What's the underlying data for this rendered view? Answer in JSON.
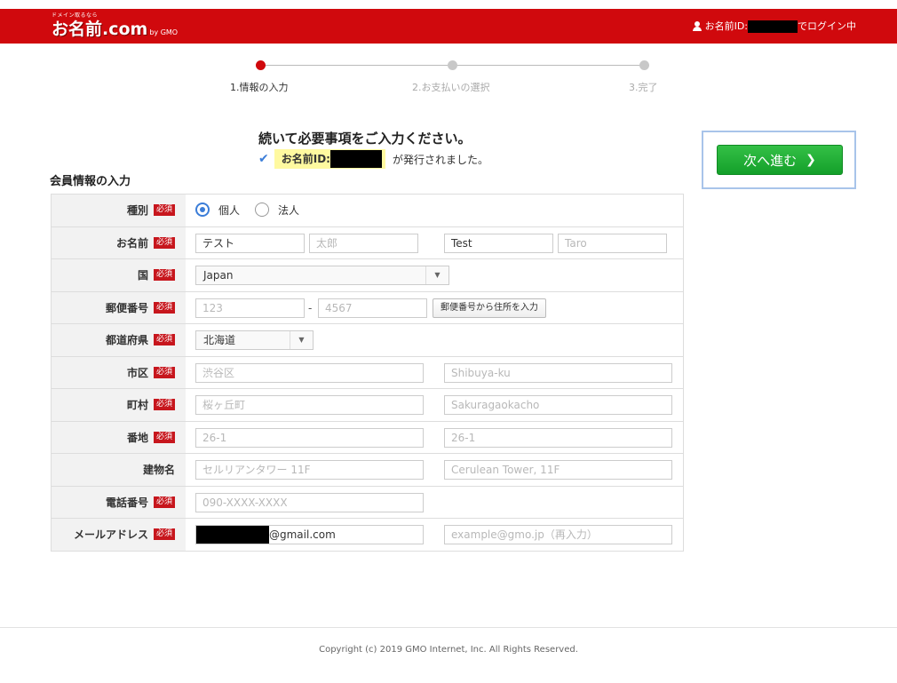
{
  "header": {
    "logo_tag": "ドメイン取るなら",
    "logo_main": "お名前.com",
    "logo_sub": "by GMO",
    "login_prefix": "お名前ID:",
    "login_suffix": "でログイン中"
  },
  "stepper": {
    "steps": [
      {
        "label": "1.情報の入力",
        "active": true
      },
      {
        "label": "2.お支払いの選択",
        "active": false
      },
      {
        "label": "3.完了",
        "active": false
      }
    ]
  },
  "lead": "続いて必要事項をご入力ください。",
  "notice": {
    "highlight_prefix": "お名前ID:",
    "rest": "が発行されました。"
  },
  "next_button": {
    "label": "次へ進む"
  },
  "section_title": "会員情報の入力",
  "required_badge": "必須",
  "form": {
    "type": {
      "label": "種別",
      "options": [
        "個人",
        "法人"
      ],
      "selected": "個人"
    },
    "name": {
      "label": "お名前",
      "last_name": "テスト",
      "first_name_placeholder": "太郎",
      "last_name_en": "Test",
      "first_name_en_placeholder": "Taro"
    },
    "country": {
      "label": "国",
      "value": "Japan"
    },
    "postal": {
      "label": "郵便番号",
      "part1_placeholder": "123",
      "part2_placeholder": "4567",
      "lookup_button": "郵便番号から住所を入力"
    },
    "prefecture": {
      "label": "都道府県",
      "value": "北海道"
    },
    "city": {
      "label": "市区",
      "placeholder_ja": "渋谷区",
      "placeholder_en": "Shibuya-ku"
    },
    "town": {
      "label": "町村",
      "placeholder_ja": "桜ヶ丘町",
      "placeholder_en": "Sakuragaokacho"
    },
    "address": {
      "label": "番地",
      "placeholder_ja": "26-1",
      "placeholder_en": "26-1"
    },
    "building": {
      "label": "建物名",
      "placeholder_ja": "セルリアンタワー 11F",
      "placeholder_en": "Cerulean Tower, 11F"
    },
    "phone": {
      "label": "電話番号",
      "placeholder": "090-XXXX-XXXX"
    },
    "email": {
      "label": "メールアドレス",
      "value_suffix": "@gmail.com",
      "confirm_placeholder": "example@gmo.jp（再入力）"
    }
  },
  "footer": {
    "copyright": "Copyright (c) 2019 GMO Internet, Inc. All Rights Reserved."
  },
  "colors": {
    "brand_red": "#d0090d",
    "next_green": "#1aa82f",
    "accent_blue": "#3b7dd8",
    "highlight_yellow": "#fff9a0"
  }
}
